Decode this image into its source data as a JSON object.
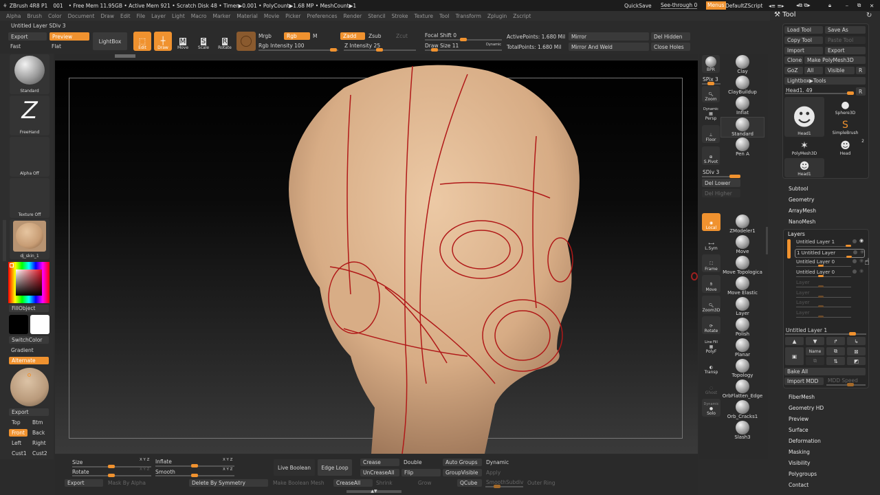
{
  "titlebar": {
    "app": "ZBrush 4R8 P1",
    "doc": "001",
    "stats": "• Free Mem 11.95GB • Active Mem 921 • Scratch Disk 48 • Timer▶0.001 • PolyCount▶1.68 MP • MeshCount▶1",
    "quicksave": "QuickSave",
    "see_through": "See-through  0",
    "menus": "Menus",
    "default_zscript": "DefaultZScript"
  },
  "menubar": [
    "Alpha",
    "Brush",
    "Color",
    "Document",
    "Draw",
    "Edit",
    "File",
    "Layer",
    "Light",
    "Macro",
    "Marker",
    "Material",
    "Movie",
    "Picker",
    "Preferences",
    "Render",
    "Stencil",
    "Stroke",
    "Texture",
    "Tool",
    "Transform",
    "Zplugin",
    "Zscript"
  ],
  "status_line": "Untitled Layer SDiv 3",
  "toolbar": {
    "export": "Export",
    "preview": "Preview",
    "fast": "Fast",
    "flat": "Flat",
    "lightbox": "LightBox",
    "edit": "Edit",
    "draw": "Draw",
    "move": "Move",
    "scale": "Scale",
    "rotate": "Rotate",
    "mrgb": "Mrgb",
    "rgb": "Rgb",
    "m": "M",
    "rgb_intensity": "Rgb Intensity 100",
    "rgb_intensity_value": 100,
    "zadd": "Zadd",
    "zsub": "Zsub",
    "zcut": "Zcut",
    "z_intensity": "Z Intensity 25",
    "z_intensity_value": 25,
    "focal_shift": "Focal Shift 0",
    "draw_size": "Draw Size 11",
    "dynamic": "Dynamic",
    "active_points": "ActivePoints: 1.680 Mil",
    "total_points": "TotalPoints: 1.680 Mil",
    "mirror": "Mirror",
    "mirror_and_weld": "Mirror And Weld",
    "del_hidden": "Del Hidden",
    "close_holes": "Close Holes"
  },
  "left_shelf": {
    "brush": "Standard",
    "stroke": "FreeHand",
    "alpha": "Alpha Off",
    "texture": "Texture Off",
    "material": "dj_skin_1",
    "fill_object": "FillObject",
    "switch_color": "SwitchColor",
    "gradient": "Gradient",
    "alternate": "Alternate",
    "export": "Export",
    "views": [
      "Top",
      "Btm",
      "Front",
      "Back",
      "Left",
      "Right",
      "Cust1",
      "Cust2"
    ],
    "active_view": "Front",
    "main_color": "#000000",
    "secondary_color": "#ffffff"
  },
  "right_shelf": {
    "bpr": "BPR",
    "spix": "SPix 3",
    "zoom": "Zoom",
    "dynamic": "Dynamic",
    "persp": "Persp",
    "floor": "Floor",
    "spivot": "S.Pivot",
    "sdiv": "SDiv 3",
    "del_lower": "Del Lower",
    "del_higher": "Del Higher",
    "local": "Local",
    "lsym": "L.Sym",
    "frame": "Frame",
    "move": "Move",
    "zoom3d": "Zoom3D",
    "rotate": "Rotate",
    "line_fill": "Line Fill",
    "polyf": "PolyF",
    "transp": "Transp",
    "ghost": "Ghost",
    "solo_dynamic": "Dynamic",
    "solo": "Solo"
  },
  "brushes": [
    "Clay",
    "ClayBuildup",
    "Inflat",
    "Standard",
    "Pen A",
    "ZModeler1",
    "Move",
    "Move Topologica",
    "Move Elastic",
    "Layer",
    "Polish",
    "Planar",
    "Topology",
    "OrbFlatten_Edge",
    "Orb_Cracks1",
    "Slash3"
  ],
  "tool_panel": {
    "title": "Tool",
    "load_tool": "Load Tool",
    "save_as": "Save As",
    "copy_tool": "Copy Tool",
    "paste_tool": "Paste Tool",
    "import": "Import",
    "export": "Export",
    "clone": "Clone",
    "make_polymesh": "Make PolyMesh3D",
    "goz": "GoZ",
    "all": "All",
    "visible": "Visible",
    "r": "R",
    "lightbox_tools": "Lightbox▶Tools",
    "head_slider": "Head1. 49",
    "tools": [
      {
        "name": "Head1"
      },
      {
        "name": "Sphere3D"
      },
      {
        "name": "SimpleBrush"
      },
      {
        "name": "PolyMesh3D"
      },
      {
        "name": "Head",
        "count": "2"
      },
      {
        "name": "Head1"
      }
    ],
    "sections_top": [
      "Subtool",
      "Geometry",
      "ArrayMesh",
      "NanoMesh"
    ],
    "layers": {
      "title": "Layers",
      "items": [
        "Untitled Layer 1",
        "1 Untitled Layer",
        "Untitled Layer 0",
        "Untitled Layer 0",
        "Layer",
        "Layer",
        "Layer",
        "Layer"
      ],
      "current": "Untitled Layer 1",
      "name_button": "Name",
      "bake_all": "Bake All",
      "import_mdd": "Import MDD",
      "mdd_speed": "MDD Speed"
    },
    "sections_bottom": [
      "FiberMesh",
      "Geometry HD",
      "Preview",
      "Surface",
      "Deformation",
      "Masking",
      "Visibility",
      "Polygroups",
      "Contact"
    ]
  },
  "bottom": {
    "size": "Size",
    "rotate": "Rotate",
    "inflate": "Inflate",
    "smooth": "Smooth",
    "xyz": "X Y Z",
    "export": "Export",
    "mask_by_alpha": "Mask By Alpha",
    "delete_by_symmetry": "Delete By Symmetry",
    "live_boolean": "Live Boolean",
    "make_boolean_mesh": "Make Boolean Mesh",
    "edge_loop": "Edge Loop",
    "crease": "Crease",
    "uncrease_all": "UnCreaseAll",
    "crease_all": "CreaseAll",
    "shrink": "Shrink",
    "grow": "Grow",
    "double": "Double",
    "flip": "Flip",
    "auto_groups": "Auto Groups",
    "group_visible": "GroupVisible",
    "qcube": "QCube",
    "dynamic": "Dynamic",
    "apply": "Apply",
    "smooth_subdiv": "SmoothSubdiv",
    "outer_ring": "Outer Ring"
  },
  "colors": {
    "accent": "#f0922f",
    "bg": "#2b2b2b",
    "topology_lines": "#b01818",
    "skin": "#e3bc96"
  }
}
